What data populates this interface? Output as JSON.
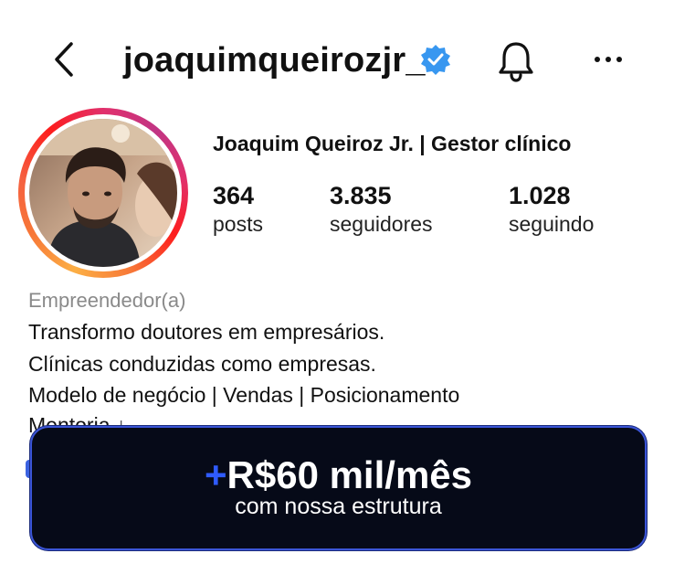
{
  "header": {
    "username": "joaquimqueirozjr_",
    "back_icon": "chevron-left-icon",
    "verified_icon": "verified-badge-icon",
    "bell_icon": "bell-icon",
    "more_icon": "more-horizontal-icon"
  },
  "profile": {
    "display_name": "Joaquim Queiroz Jr. | Gestor clínico",
    "stats": [
      {
        "value": "364",
        "label": "posts"
      },
      {
        "value": "3.835",
        "label": "seguidores"
      },
      {
        "value": "1.028",
        "label": "seguindo"
      }
    ],
    "category": "Empreendedor(a)",
    "bio": [
      "Transformo doutores em empresários.",
      "Clínicas conduzidas como empresas.",
      "Modelo de negócio | Vendas | Posicionamento",
      "Mentoria ↓"
    ]
  },
  "cta": {
    "plus": "+",
    "title": "R$60 mil/mês",
    "subtitle": "com nossa estrutura"
  },
  "colors": {
    "verified": "#3897f0",
    "cta_background": "#060a18",
    "cta_border": "#3b55d6",
    "cta_plus": "#2f5bff"
  }
}
